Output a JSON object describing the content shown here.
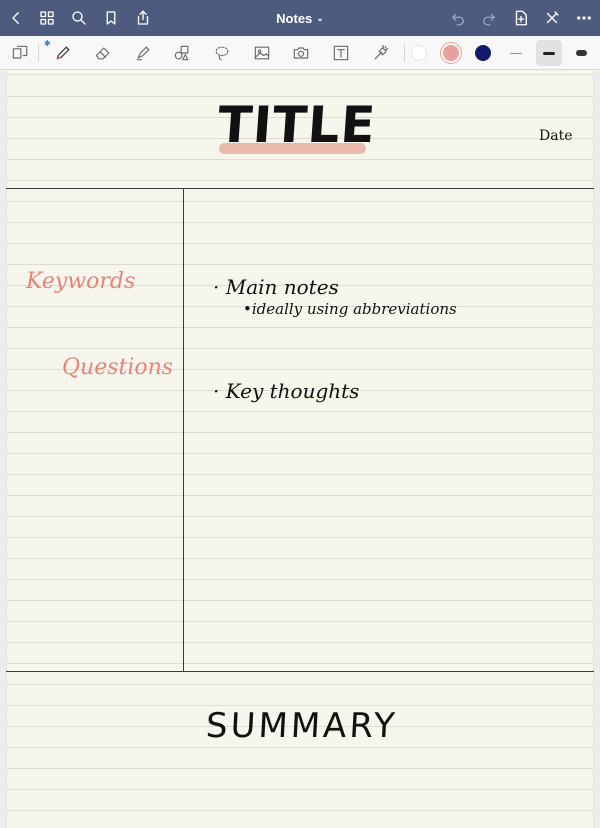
{
  "app": {
    "title": "Notes",
    "title_chevron": "⌄"
  },
  "toolbar": {
    "bluetooth_glyph": "✱",
    "tools": [
      "pages-icon",
      "pen-icon",
      "eraser-icon",
      "highlighter-icon",
      "shapes-icon",
      "lasso-icon",
      "image-icon",
      "camera-icon",
      "text-box-icon",
      "laser-pointer-icon"
    ],
    "colors": [
      "#ffffff",
      "#e8a09a",
      "#141a6b"
    ],
    "selected_color": "#e8a09a",
    "stroke_sizes": [
      "thin",
      "medium",
      "thick"
    ],
    "selected_size": "medium"
  },
  "page": {
    "title": "TITLE",
    "date": "Date",
    "keywords": "Keywords",
    "questions": "Questions",
    "main_notes": "· Main notes",
    "sub_note": "•ideally using abbreviations",
    "key_thoughts": "· Key thoughts",
    "summary": "SUMMARY"
  },
  "colors": {
    "nav_bar": "#4e5a7e",
    "paper": "#f7f6ec",
    "cue_ink": "#e5847b",
    "title_highlight": "#e8b2a6"
  }
}
